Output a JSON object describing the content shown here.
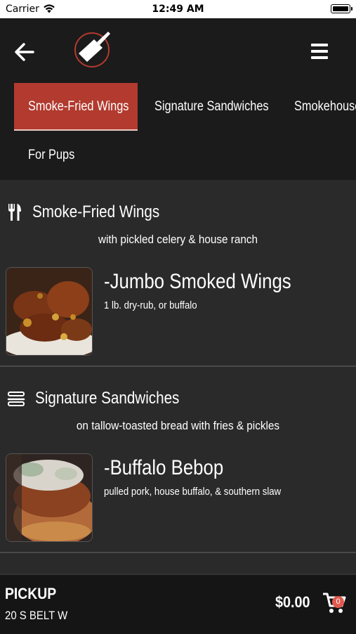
{
  "status_bar": {
    "carrier": "Carrier",
    "time": "12:49 AM"
  },
  "header": {
    "back_icon": "arrow-left-icon",
    "logo_icon": "cleaver-logo-icon",
    "menu_icon": "hamburger-menu-icon"
  },
  "tabs": [
    {
      "label": "Smoke-Fried Wings",
      "active": true
    },
    {
      "label": "Signature Sandwiches",
      "active": false
    },
    {
      "label": "Smokehouse",
      "active": false
    },
    {
      "label": "For Pups",
      "active": false
    }
  ],
  "sections": [
    {
      "icon": "fork-knife-icon",
      "title": "Smoke-Fried Wings",
      "subtitle": "with pickled celery & house ranch",
      "items": [
        {
          "name": "-Jumbo Smoked Wings",
          "description": "1 lb. dry-rub, or buffalo"
        }
      ]
    },
    {
      "icon": "sandwich-icon",
      "title": "Signature Sandwiches",
      "subtitle": "on tallow-toasted bread with fries & pickles",
      "items": [
        {
          "name": "-Buffalo Bebop",
          "description": "pulled pork, house buffalo, & southern slaw"
        }
      ]
    }
  ],
  "footer": {
    "mode": "PICKUP",
    "address": "20 S BELT W",
    "total": "$0.00",
    "cart_count": "0",
    "cart_icon": "shopping-cart-icon"
  },
  "colors": {
    "accent": "#b23a2e",
    "header_bg": "#1b1b1b",
    "content_bg": "#2a2a2a"
  }
}
